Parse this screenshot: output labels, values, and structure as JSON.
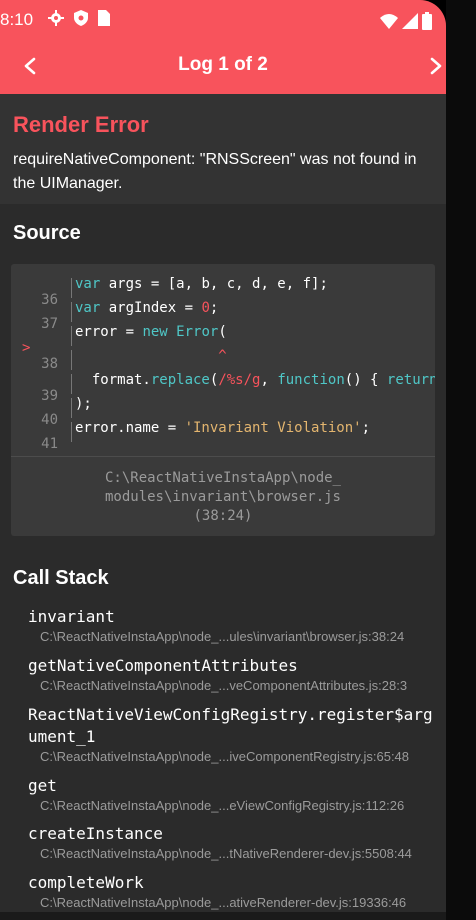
{
  "status_bar": {
    "time": "8:10",
    "icons": [
      "gear-icon",
      "shield-icon",
      "sim-card-icon"
    ],
    "right_icons": [
      "wifi-icon",
      "signal-icon",
      "battery-icon"
    ]
  },
  "header": {
    "title": "Log 1 of 2",
    "prev_icon": "chevron-left-icon",
    "next_icon": "chevron-right-icon"
  },
  "error": {
    "title": "Render Error",
    "message": "requireNativeComponent: \"RNSScreen\" was not found in the UIManager."
  },
  "source": {
    "title": "Source",
    "lines": [
      {
        "num": "36",
        "marker": "",
        "text": "var args = [a, b, c, d, e, f];"
      },
      {
        "num": "37",
        "marker": "",
        "text": "var argIndex = 0;"
      },
      {
        "num": "38",
        "marker": ">",
        "text": "error = new Error("
      },
      {
        "num": "",
        "marker": "",
        "text": "                 ^"
      },
      {
        "num": "39",
        "marker": "",
        "text": "  format.replace(/%s/g, function() { return"
      },
      {
        "num": "40",
        "marker": "",
        "text": ");"
      },
      {
        "num": "41",
        "marker": "",
        "text": "error.name = 'Invariant Violation';"
      }
    ],
    "file_path": "C:\\ReactNativeInstaApp\\node_\nmodules\\invariant\\browser.js\n(38:24)"
  },
  "call_stack": {
    "title": "Call Stack",
    "frames": [
      {
        "fn": "invariant",
        "loc": "C:\\ReactNativeInstaApp\\node_...ules\\invariant\\browser.js:38:24"
      },
      {
        "fn": "getNativeComponentAttributes",
        "loc": "C:\\ReactNativeInstaApp\\node_...veComponentAttributes.js:28:3"
      },
      {
        "fn": "ReactNativeViewConfigRegistry.register$argument_1",
        "loc": "C:\\ReactNativeInstaApp\\node_...iveComponentRegistry.js:65:48"
      },
      {
        "fn": "get",
        "loc": "C:\\ReactNativeInstaApp\\node_...eViewConfigRegistry.js:112:26"
      },
      {
        "fn": "createInstance",
        "loc": "C:\\ReactNativeInstaApp\\node_...tNativeRenderer-dev.js:5508:44"
      },
      {
        "fn": "completeWork",
        "loc": "C:\\ReactNativeInstaApp\\node_...ativeRenderer-dev.js:19336:46"
      }
    ]
  },
  "colors": {
    "accent": "#f8535c",
    "background": "#2b2b2b",
    "panel": "#333333",
    "code_bg": "#3a3a3a"
  }
}
